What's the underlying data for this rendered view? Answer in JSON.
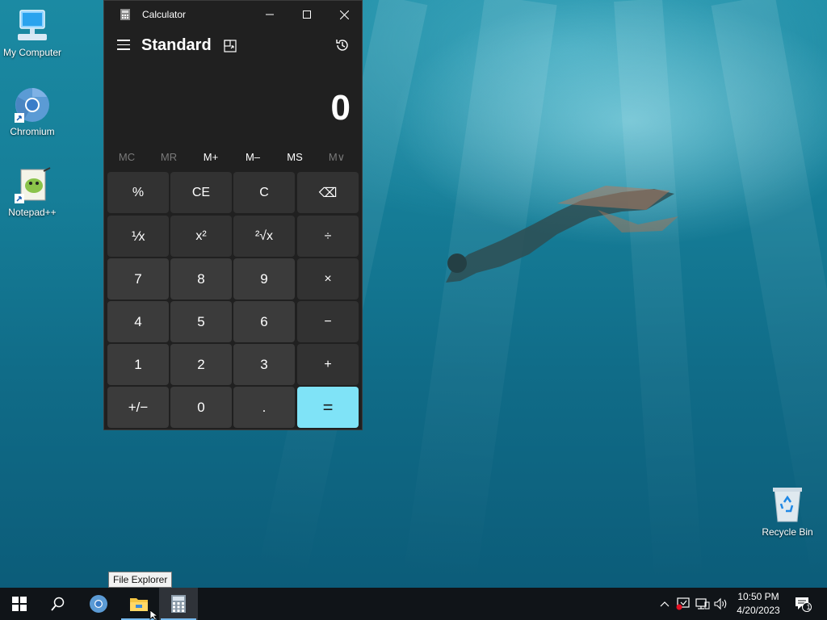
{
  "desktop": {
    "icons": [
      {
        "label": "My Computer"
      },
      {
        "label": "Chromium"
      },
      {
        "label": "Notepad++"
      },
      {
        "label": "Recycle Bin"
      }
    ]
  },
  "calculator": {
    "window_title": "Calculator",
    "mode": "Standard",
    "display_value": "0",
    "memory_buttons": [
      "MC",
      "MR",
      "M+",
      "M–",
      "MS",
      "M∨"
    ],
    "keys": [
      [
        "%",
        "CE",
        "C",
        "⌫"
      ],
      [
        "⅟x",
        "x²",
        "²√x",
        "÷"
      ],
      [
        "7",
        "8",
        "9",
        "×"
      ],
      [
        "4",
        "5",
        "6",
        "−"
      ],
      [
        "1",
        "2",
        "3",
        "+"
      ],
      [
        "+/−",
        "0",
        ".",
        "="
      ]
    ]
  },
  "tooltip": {
    "text": "File Explorer"
  },
  "taskbar": {
    "time": "10:50 PM",
    "date": "4/20/2023",
    "notification_count": "1"
  },
  "colors": {
    "accent_equals": "#7fe3f7",
    "window_bg": "#202020",
    "key_bg": "#3b3b3b",
    "taskbar_bg": "#101418"
  }
}
